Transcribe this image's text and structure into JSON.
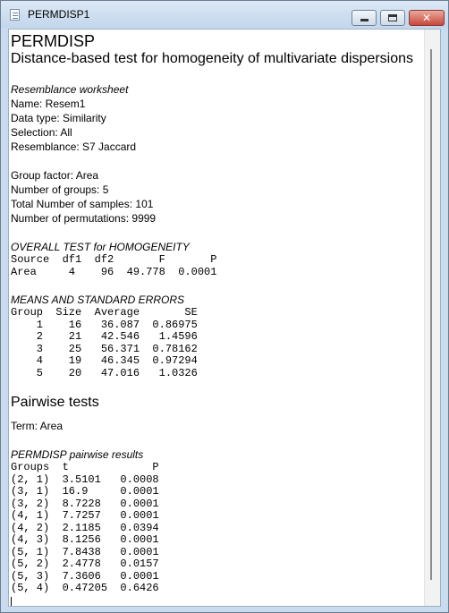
{
  "window": {
    "title": "PERMDISP1"
  },
  "doc": {
    "heading": "PERMDISP",
    "subheading": "Distance-based test for homogeneity of multivariate dispersions",
    "resemblance_heading": "Resemblance worksheet",
    "info": [
      "Name: Resem1",
      "Data type: Similarity",
      "Selection: All",
      "Resemblance: S7 Jaccard"
    ],
    "group_info": [
      "Group factor: Area",
      "Number of groups: 5",
      "Total Number of samples: 101",
      "Number of permutations: 9999"
    ],
    "overall_heading": "OVERALL TEST for HOMOGENEITY",
    "overall_header": "Source  df1  df2       F       P",
    "overall_row": "Area     4    96  49.778  0.0001",
    "means_heading": "MEANS AND STANDARD ERRORS",
    "means_rows": [
      "Group  Size  Average       SE",
      "    1    16   36.087  0.86975",
      "    2    21   42.546   1.4596",
      "    3    25   56.371  0.78162",
      "    4    19   46.345  0.97294",
      "    5    20   47.016   1.0326"
    ],
    "pairwise_heading": "Pairwise tests",
    "term": "Term: Area",
    "pairwise_results_heading": "PERMDISP pairwise results",
    "pairwise_rows": [
      "Groups  t             P",
      "(2, 1)  3.5101   0.0008",
      "(3, 1)  16.9     0.0001",
      "(3, 2)  8.7228   0.0001",
      "(4, 1)  7.7257   0.0001",
      "(4, 2)  2.1185   0.0394",
      "(4, 3)  8.1256   0.0001",
      "(5, 1)  7.8438   0.0001",
      "(5, 2)  2.4778   0.0157",
      "(5, 3)  7.3606   0.0001",
      "(5, 4)  0.47205  0.6426"
    ]
  }
}
